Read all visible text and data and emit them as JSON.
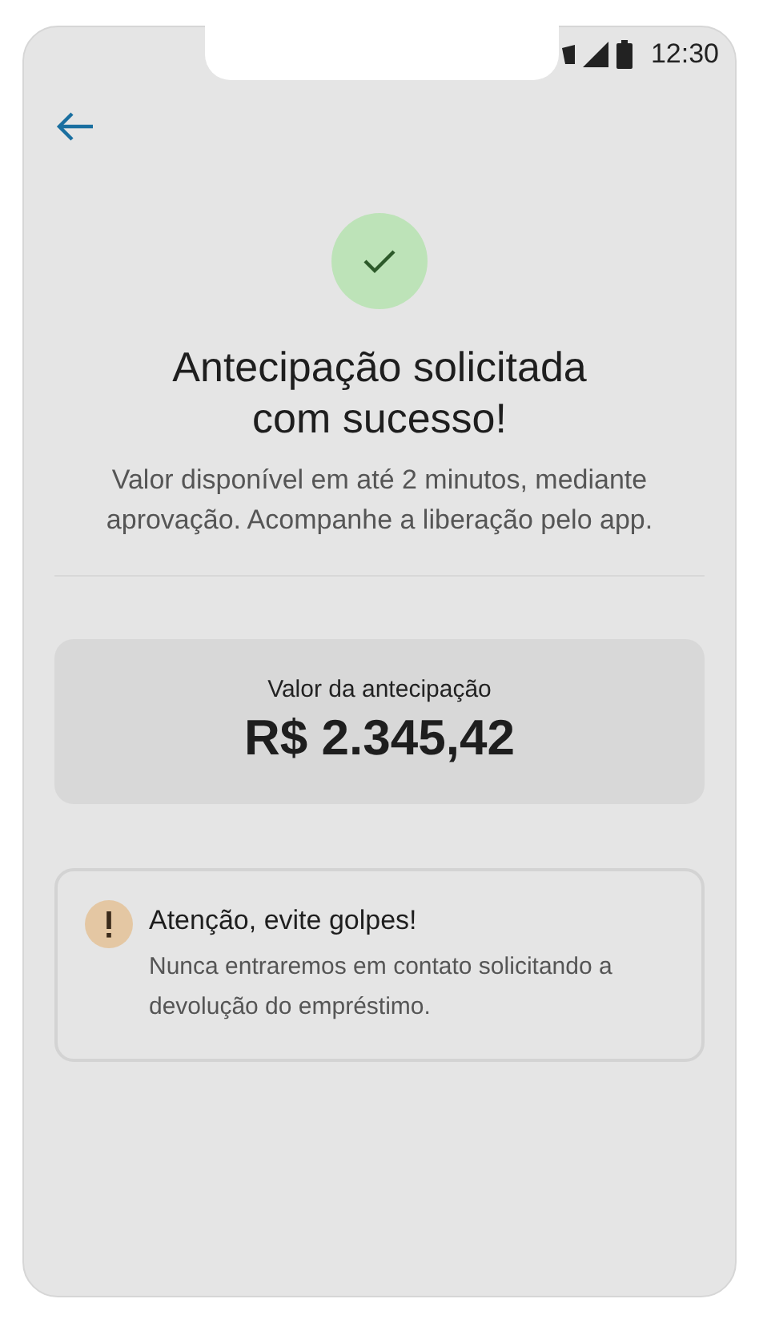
{
  "status_bar": {
    "time": "12:30"
  },
  "success": {
    "title_lines": [
      "Antecipação solicitada",
      "com sucesso!"
    ],
    "message": "Valor disponível em até 2 minutos, mediante aprovação. Acompanhe a liberação pelo app."
  },
  "amount_card": {
    "label": "Valor da antecipação",
    "value": "R$ 2.345,42"
  },
  "warning": {
    "title": "Atenção, evite golpes!",
    "body": "Nunca entraremos em contato solicitando a devolução do empréstimo."
  }
}
